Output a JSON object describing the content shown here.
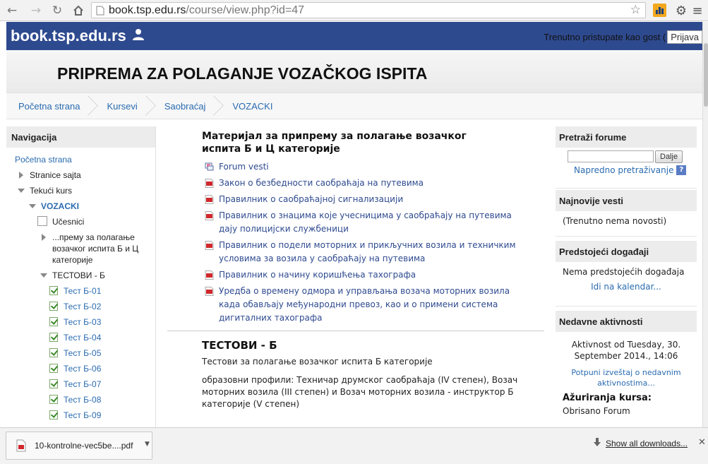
{
  "browser": {
    "url_host": "book.tsp.edu.rs",
    "url_path": "/course/view.php?id=47"
  },
  "topbar": {
    "logo": "book.tsp.edu.rs",
    "guest_text": "Trenutno pristupate kao gost (",
    "login_label": "Prijava"
  },
  "course_title": "PRIPREMA ZA POLAGANJE VOZAČKOG ISPITA",
  "breadcrumb": [
    "Početna strana",
    "Kursevi",
    "Saobraćaj",
    "VOZACKI"
  ],
  "navigation": {
    "title": "Navigacija",
    "home": "Početna strana",
    "site_pages": "Stranice sajta",
    "current_course": "Tekući kurs",
    "course": "VOZACKI",
    "participants": "Učesnici",
    "section1_line1": "...премy за полагање",
    "section1_line2": "возачког испита Б и Ц",
    "section1_line3": "категорије",
    "section2": "ТЕСТОВИ - Б",
    "tests": [
      "Тест Б-01",
      "Тест Б-02",
      "Тест Б-03",
      "Тест Б-04",
      "Тест Б-05",
      "Тест Б-06",
      "Тест Б-07",
      "Тест Б-08",
      "Тест Б-09"
    ]
  },
  "main": {
    "section1_title_line1": "Материјал за припрему за полагање возачког",
    "section1_title_line2": "испита Б и Ц категорије",
    "resources": [
      {
        "line1": "Forum vesti",
        "line2": "",
        "line3": "",
        "icon": "forum-icon"
      },
      {
        "line1": "Закон о безбедности саобраћаја на путевима",
        "line2": "",
        "line3": "",
        "icon": "pdf-icon"
      },
      {
        "line1": "Правилник о саобраћајној сигнализацији",
        "line2": "",
        "line3": "",
        "icon": "pdf-icon"
      },
      {
        "line1": "Правилник о знацима које учесницима у саобраћају на путевима",
        "line2": "дају полицијски службеници",
        "line3": "",
        "icon": "pdf-icon"
      },
      {
        "line1": "Правилник о подели моторних и прикључних возила и техничким",
        "line2": "условима за возила у саобраћају на путевима",
        "line3": "",
        "icon": "pdf-icon"
      },
      {
        "line1": "Правилник о начину коришћења тахографа",
        "line2": "",
        "line3": "",
        "icon": "pdf-icon"
      },
      {
        "line1": "Уредба о времену одмора и управљања возача моторних возила",
        "line2": "када обављају међународни превоз, као и о примени система",
        "line3": "дигиталних тахографа",
        "icon": "pdf-icon"
      }
    ],
    "section2_title": "ТЕСТОВИ - Б",
    "section2_summary": "Тестови за полагање возачког испита Б категорије",
    "section2_profiles_line1": "образовни профили: Техничар друмског саобраћаја (IV степен), Возач",
    "section2_profiles_line2": "моторних возила (III степен) и Возач моторних возила - инструктор Б",
    "section2_profiles_line3": "категорије (V степен)"
  },
  "right": {
    "search_title": "Pretraži forume",
    "search_button": "Dalje",
    "advanced_search": "Napredno pretraživanje",
    "news_title": "Najnovije vesti",
    "news_empty": "(Trenutno nema novosti)",
    "events_title": "Predstojeći događaji",
    "events_empty": "Nema predstojećih događaja",
    "calendar_link": "Idi na kalendar...",
    "activity_title": "Nedavne aktivnosti",
    "activity_since_line1": "Aktivnost od Tuesday, 30.",
    "activity_since_line2": "September 2014., 14:06",
    "full_report_line1": "Potpuni izveštaj o nedavnim",
    "full_report_line2": "aktivnostima...",
    "updates_title": "Ažuriranja kursa:",
    "updates_item": "Obrisano Forum"
  },
  "downloads": {
    "file_name": "10-kontrolne-vec5be....pdf",
    "show_all": "Show all downloads..."
  },
  "colors": {
    "topbar": "#2e4a8f",
    "link": "#2a6bb0"
  }
}
